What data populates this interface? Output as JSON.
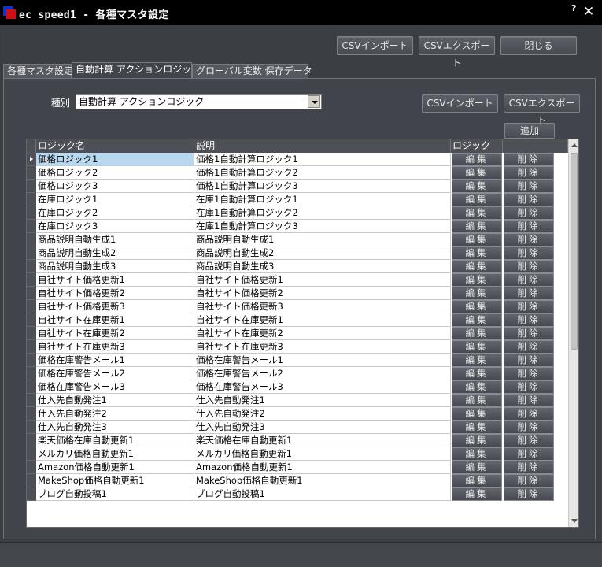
{
  "window": {
    "title": "ec speed1 - 各種マスタ設定",
    "help": "?",
    "close": "✕"
  },
  "toolbar": {
    "csv_import": "CSVインポート",
    "csv_export": "CSVエクスポート",
    "close": "閉じる"
  },
  "tabs": [
    {
      "label": "各種マスタ設定",
      "active": false
    },
    {
      "label": "自動計算 アクションロジック",
      "active": true
    },
    {
      "label": "グローバル変数 保存データ",
      "active": false
    }
  ],
  "panel": {
    "kind_label": "種別",
    "kind_value": "自動計算 アクションロジック",
    "csv_import": "CSVインポート",
    "csv_export": "CSVエクスポート",
    "add": "追加"
  },
  "grid": {
    "columns": [
      "ロジック名",
      "説明",
      "ロジック",
      ""
    ],
    "edit_label": "編集",
    "delete_label": "削除",
    "rows": [
      [
        "価格ロジック1",
        "価格1自動計算ロジック1"
      ],
      [
        "価格ロジック2",
        "価格1自動計算ロジック2"
      ],
      [
        "価格ロジック3",
        "価格1自動計算ロジック3"
      ],
      [
        "在庫ロジック1",
        "在庫1自動計算ロジック1"
      ],
      [
        "在庫ロジック2",
        "在庫1自動計算ロジック2"
      ],
      [
        "在庫ロジック3",
        "在庫1自動計算ロジック3"
      ],
      [
        "商品説明自動生成1",
        "商品説明自動生成1"
      ],
      [
        "商品説明自動生成2",
        "商品説明自動生成2"
      ],
      [
        "商品説明自動生成3",
        "商品説明自動生成3"
      ],
      [
        "自社サイト価格更新1",
        "自社サイト価格更新1"
      ],
      [
        "自社サイト価格更新2",
        "自社サイト価格更新2"
      ],
      [
        "自社サイト価格更新3",
        "自社サイト価格更新3"
      ],
      [
        "自社サイト在庫更新1",
        "自社サイト在庫更新1"
      ],
      [
        "自社サイト在庫更新2",
        "自社サイト在庫更新2"
      ],
      [
        "自社サイト在庫更新3",
        "自社サイト在庫更新3"
      ],
      [
        "価格在庫警告メール1",
        "価格在庫警告メール1"
      ],
      [
        "価格在庫警告メール2",
        "価格在庫警告メール2"
      ],
      [
        "価格在庫警告メール3",
        "価格在庫警告メール3"
      ],
      [
        "仕入先自動発注1",
        "仕入先自動発注1"
      ],
      [
        "仕入先自動発注2",
        "仕入先自動発注2"
      ],
      [
        "仕入先自動発注3",
        "仕入先自動発注3"
      ],
      [
        "楽天価格在庫自動更新1",
        "楽天価格在庫自動更新1"
      ],
      [
        "メルカリ価格自動更新1",
        "メルカリ価格自動更新1"
      ],
      [
        "Amazon価格自動更新1",
        "Amazon価格自動更新1"
      ],
      [
        "MakeShop価格自動更新1",
        "MakeShop価格自動更新1"
      ],
      [
        "ブログ自動投稿1",
        "ブログ自動投稿1"
      ]
    ]
  }
}
